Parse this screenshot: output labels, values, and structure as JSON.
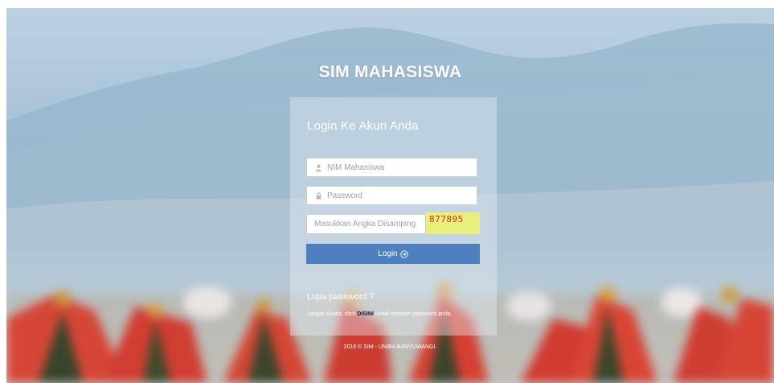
{
  "app": {
    "title": "SIM MAHASISWA"
  },
  "login_form": {
    "heading": "Login Ke Akun Anda",
    "nim_field": {
      "placeholder": "NIM Mahasiswa",
      "icon": "user-icon"
    },
    "password_field": {
      "placeholder": "Password",
      "icon": "lock-icon"
    },
    "captcha_field": {
      "placeholder": "Masukkan Angka Disamping"
    },
    "captcha_code": "877895",
    "login_button": {
      "label": "Login",
      "icon": "arrow-circle-right-icon"
    }
  },
  "forgot": {
    "heading": "Lupa password ?",
    "text_before": "Jangan Kuatir, click ",
    "link_label": "DISINI",
    "text_after": " untuk mereset password anda."
  },
  "footer": {
    "text": "2018 © SIM - UNIBA BANYUWANGI."
  },
  "colors": {
    "accent": "#4e7fbf",
    "captcha_bg": "#e9ef7b",
    "captcha_text": "#d8322a",
    "link": "#0f1e3b"
  }
}
